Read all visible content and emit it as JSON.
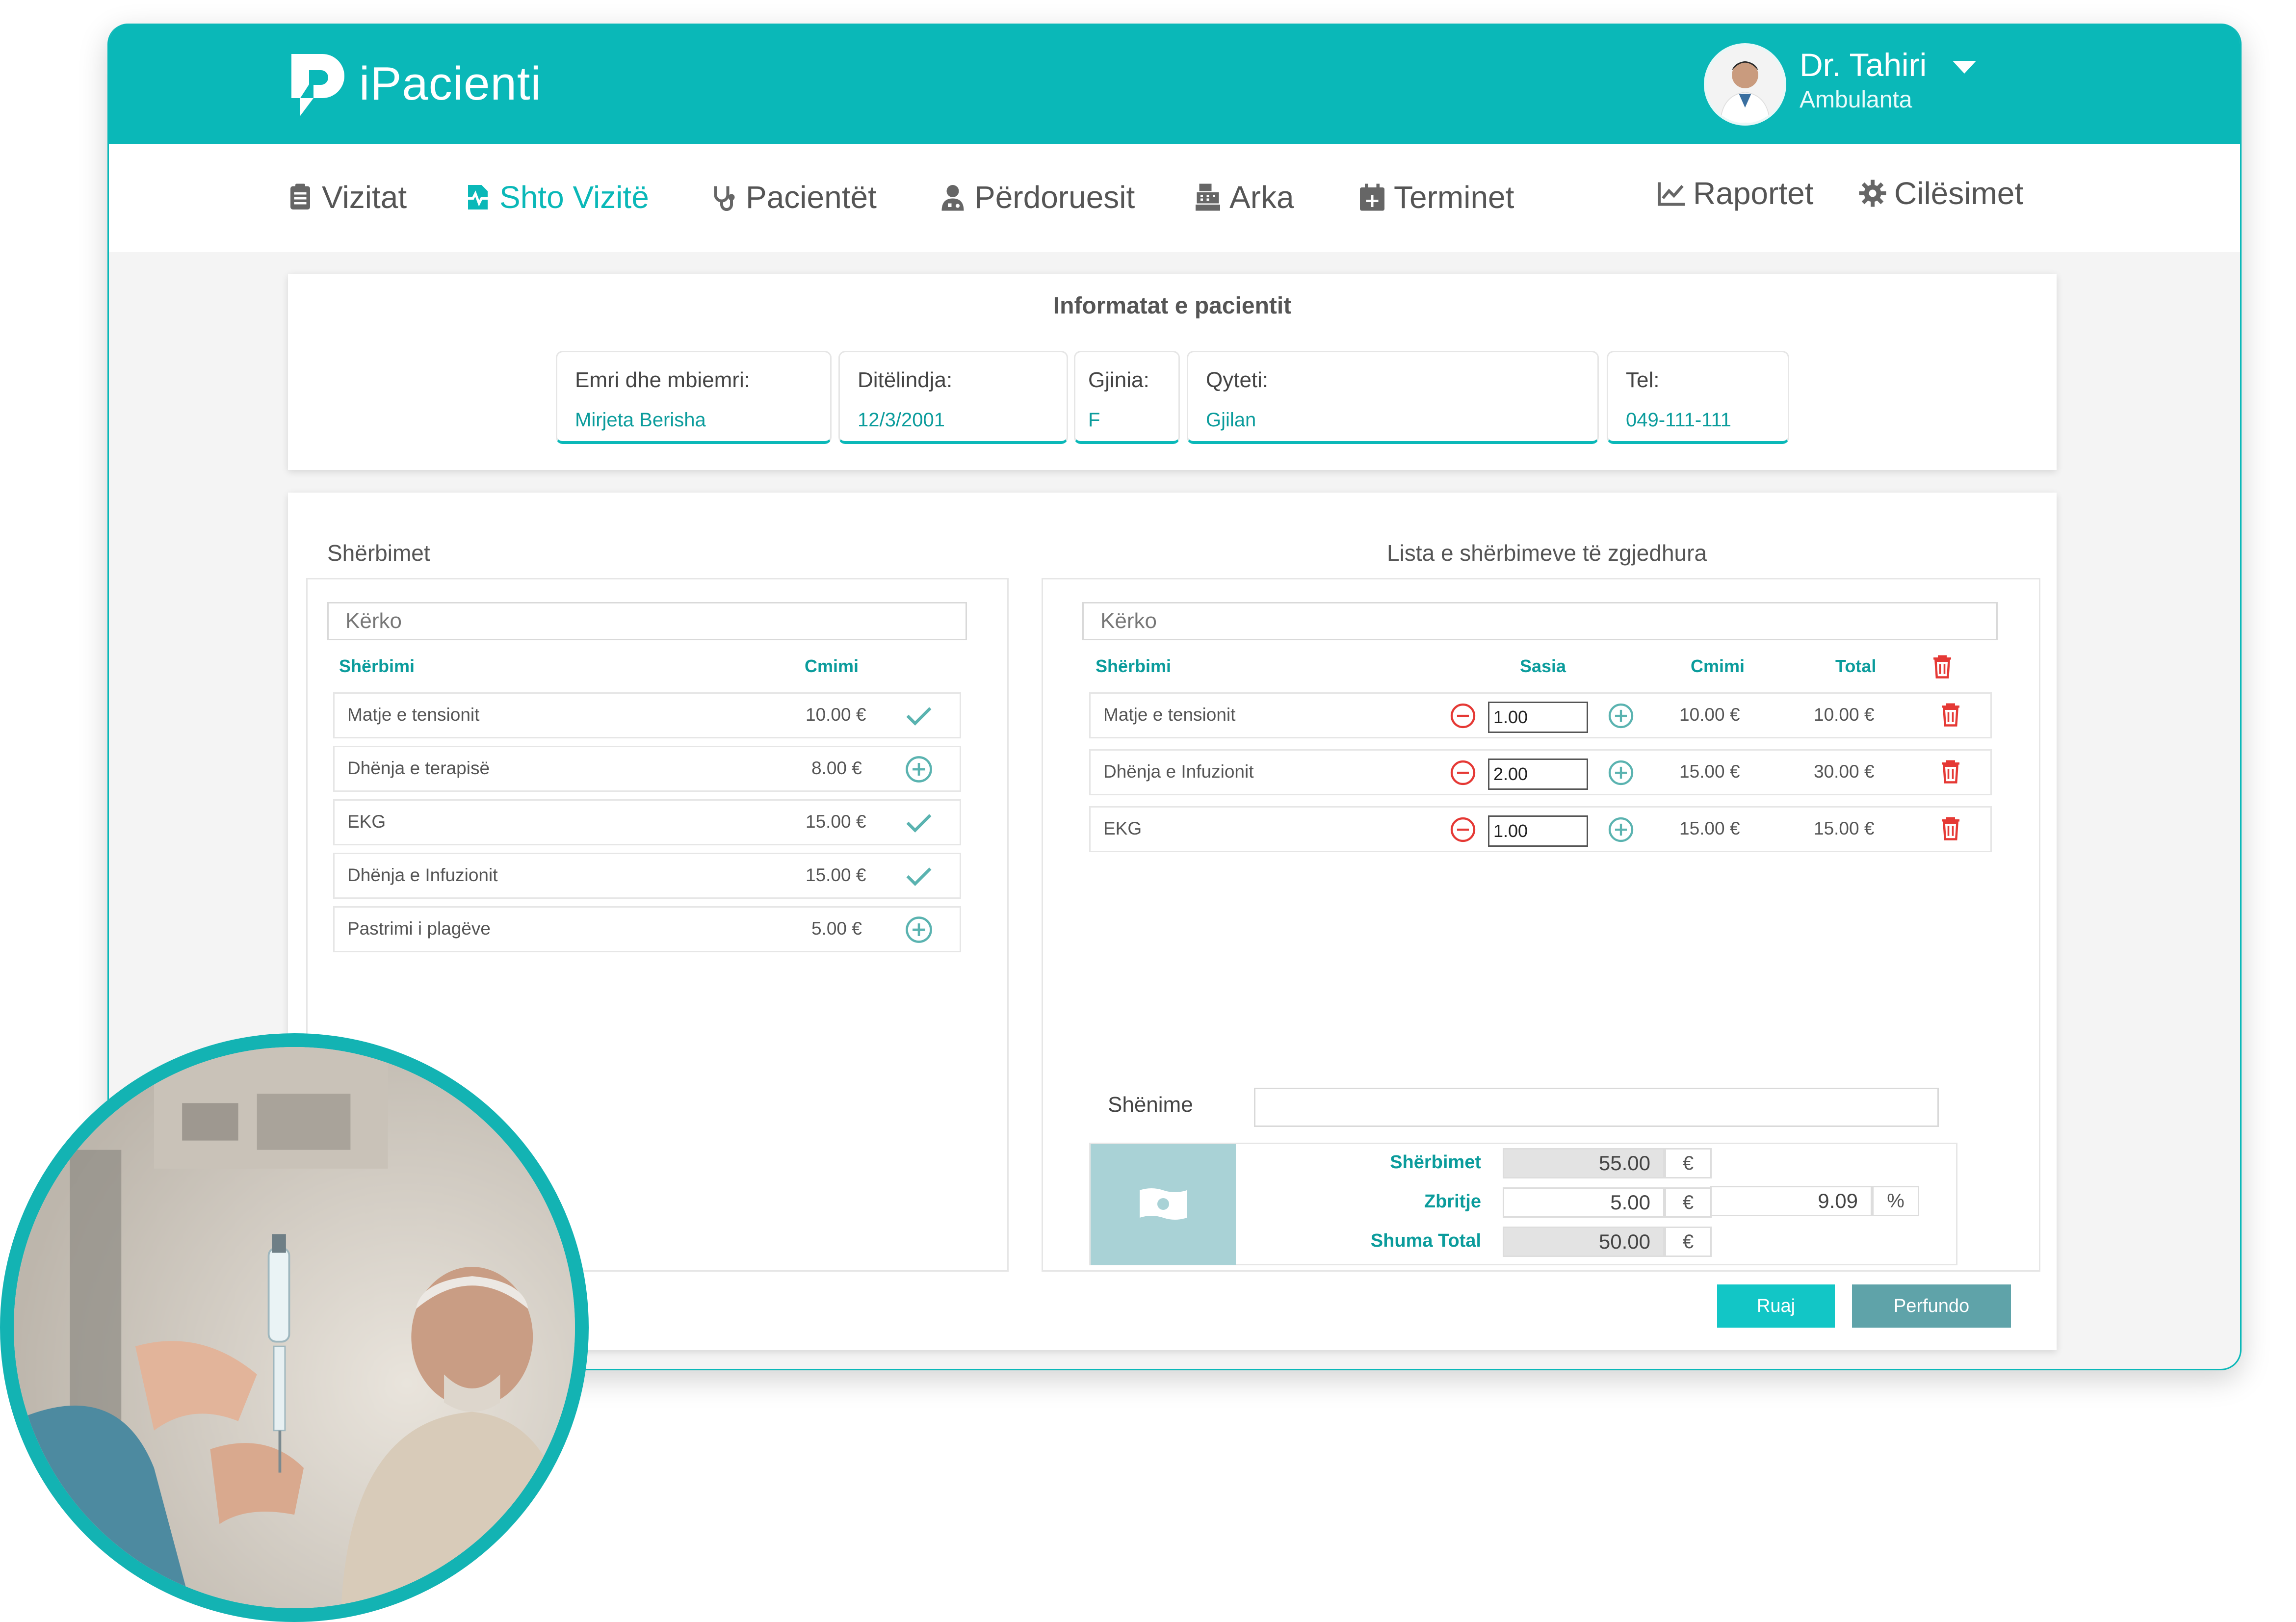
{
  "app": {
    "brand": "iPacienti"
  },
  "user": {
    "name": "Dr. Tahiri",
    "role": "Ambulanta"
  },
  "nav": [
    {
      "label": "Vizitat",
      "icon": "clipboard-icon"
    },
    {
      "label": "Shto Vizitë",
      "icon": "heartbeat-file-icon",
      "active": true
    },
    {
      "label": "Pacientët",
      "icon": "stethoscope-icon"
    },
    {
      "label": "Përdoruesit",
      "icon": "user-doctor-icon"
    },
    {
      "label": "Arka",
      "icon": "cash-register-icon"
    },
    {
      "label": "Terminet",
      "icon": "calendar-plus-icon"
    },
    {
      "label": "Raportet",
      "icon": "chart-line-icon"
    },
    {
      "label": "Cilësimet",
      "icon": "gear-icon"
    }
  ],
  "patient": {
    "title": "Informatat e pacientit",
    "fields": [
      {
        "label": "Emri dhe mbiemri:",
        "value": "Mirjeta Berisha"
      },
      {
        "label": "Ditëlindja:",
        "value": "12/3/2001"
      },
      {
        "label": "Gjinia:",
        "value": "F"
      },
      {
        "label": "Qyteti:",
        "value": "Gjilan"
      },
      {
        "label": "Tel:",
        "value": "049-111-111"
      }
    ]
  },
  "services": {
    "title": "Shërbimet",
    "search_placeholder": "Kërko",
    "col_service": "Shërbimi",
    "col_price": "Cmimi",
    "items": [
      {
        "name": "Matje e tensionit",
        "price": "10.00 €",
        "action": "check-icon"
      },
      {
        "name": "Dhënja e terapisë",
        "price": "8.00 €",
        "action": "add-circle-icon"
      },
      {
        "name": "EKG",
        "price": "15.00 €",
        "action": "check-icon"
      },
      {
        "name": "Dhënja e Infuzionit",
        "price": "15.00 €",
        "action": "check-icon"
      },
      {
        "name": "Pastrimi i plagëve",
        "price": "5.00 €",
        "action": "add-circle-icon"
      }
    ]
  },
  "selected": {
    "title": "Lista e shërbimeve të zgjedhura",
    "search_placeholder": "Kërko",
    "col_service": "Shërbimi",
    "col_qty": "Sasia",
    "col_price": "Cmimi",
    "col_total": "Total",
    "items": [
      {
        "name": "Matje e tensionit",
        "qty": "1.00",
        "price": "10.00 €",
        "total": "10.00 €"
      },
      {
        "name": "Dhënja e Infuzionit",
        "qty": "2.00",
        "price": "15.00 €",
        "total": "30.00 €"
      },
      {
        "name": "EKG",
        "qty": "1.00",
        "price": "15.00 €",
        "total": "15.00 €"
      }
    ],
    "notes_label": "Shënime",
    "notes_value": ""
  },
  "summary": {
    "services_label": "Shërbimet",
    "services_value": "55.00",
    "services_unit": "€",
    "discount_label": "Zbritje",
    "discount_amount": "5.00",
    "discount_amount_unit": "€",
    "discount_percent": "9.09",
    "discount_percent_unit": "%",
    "total_label": "Shuma Total",
    "total_value": "50.00",
    "total_unit": "€"
  },
  "actions": {
    "save": "Ruaj",
    "finish": "Perfundo"
  },
  "colors": {
    "accent": "#0ab8b8",
    "danger": "#e53935",
    "finish_button": "#5fa3a9",
    "cash_panel": "#a9d2d6"
  }
}
